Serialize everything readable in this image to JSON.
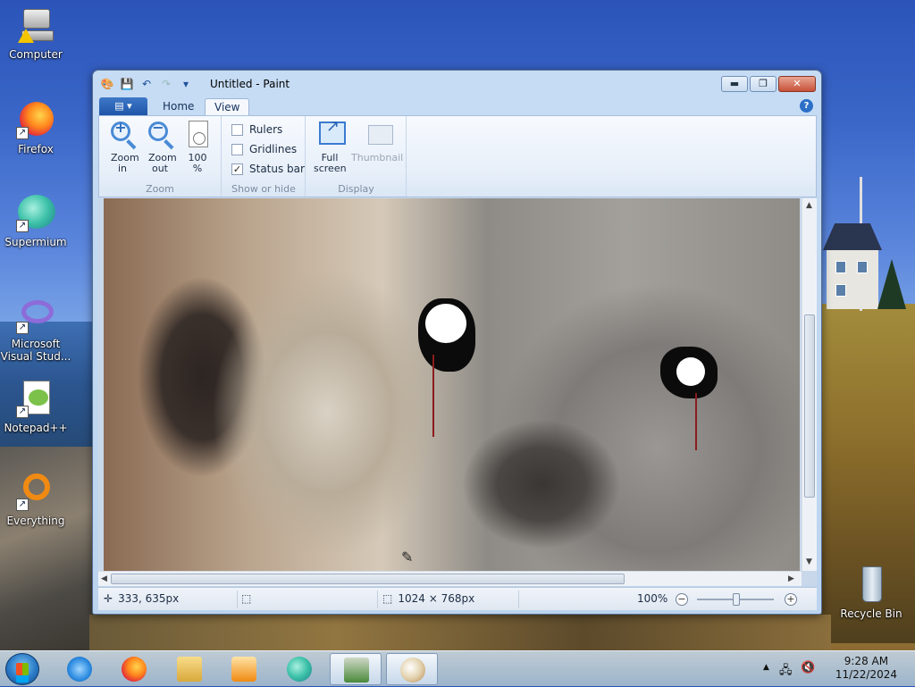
{
  "desktop": {
    "icons": [
      {
        "label": "Computer"
      },
      {
        "label": "Firefox"
      },
      {
        "label": "Supermium"
      },
      {
        "label": "Microsoft Visual Stud..."
      },
      {
        "label": "Notepad++"
      },
      {
        "label": "Everything"
      },
      {
        "label": "Recycle Bin"
      }
    ]
  },
  "window": {
    "title": "Untitled - Paint",
    "controls": {
      "minimize": "▬",
      "maximize": "❐",
      "close": "✕"
    }
  },
  "tabs": {
    "file_icon": "▤ ▾",
    "items": [
      {
        "label": "Home",
        "active": false
      },
      {
        "label": "View",
        "active": true
      }
    ],
    "help": "?"
  },
  "ribbon": {
    "zoom_group": {
      "label": "Zoom",
      "zoom_in": "Zoom in",
      "zoom_out": "Zoom out",
      "actual": "100 %"
    },
    "show_hide_group": {
      "label": "Show or hide",
      "options": [
        {
          "label": "Rulers",
          "checked": false
        },
        {
          "label": "Gridlines",
          "checked": false
        },
        {
          "label": "Status bar",
          "checked": true
        }
      ]
    },
    "display_group": {
      "label": "Display",
      "full_screen": "Full screen",
      "thumbnail": "Thumbnail"
    }
  },
  "status": {
    "cursor_pos": "333, 635px",
    "image_size": "1024 × 768px",
    "zoom": "100%"
  },
  "taskbar": {
    "time": "9:28 AM",
    "date": "11/22/2024"
  }
}
